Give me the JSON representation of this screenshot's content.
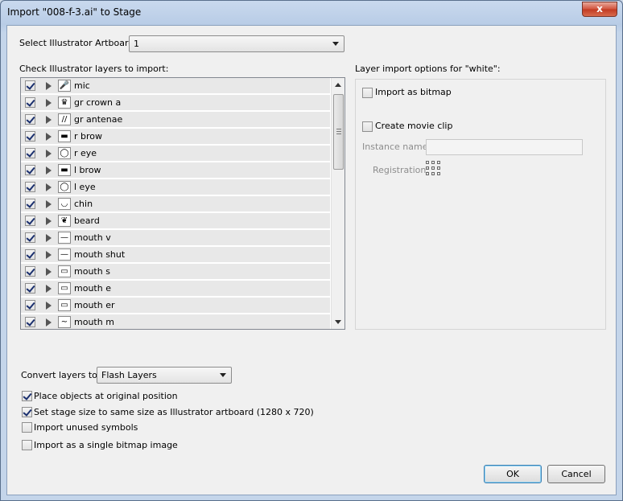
{
  "window": {
    "title": "Import \"008-f-3.ai\" to Stage",
    "close_glyph": "x"
  },
  "artboard": {
    "label": "Select Illustrator Artboard:",
    "value": "1"
  },
  "layers": {
    "label": "Check Illustrator layers to import:",
    "items": [
      {
        "name": "mic",
        "checked": true,
        "icon": "mic-thumbnail",
        "glyph": "🎤"
      },
      {
        "name": "gr crown a",
        "checked": true,
        "icon": "crown-thumbnail",
        "glyph": "♛"
      },
      {
        "name": "gr antenae",
        "checked": true,
        "icon": "antenna-thumbnail",
        "glyph": "//"
      },
      {
        "name": "r brow",
        "checked": true,
        "icon": "brow-thumbnail",
        "glyph": "▬"
      },
      {
        "name": "r eye",
        "checked": true,
        "icon": "eye-thumbnail",
        "glyph": "◯"
      },
      {
        "name": "l brow",
        "checked": true,
        "icon": "brow-thumbnail",
        "glyph": "▬"
      },
      {
        "name": "l eye",
        "checked": true,
        "icon": "eye-thumbnail",
        "glyph": "◯"
      },
      {
        "name": "chin",
        "checked": true,
        "icon": "chin-thumbnail",
        "glyph": "◡"
      },
      {
        "name": "beard",
        "checked": true,
        "icon": "beard-thumbnail",
        "glyph": "❦"
      },
      {
        "name": "mouth v",
        "checked": true,
        "icon": "mouth-thumbnail",
        "glyph": "—"
      },
      {
        "name": "mouth shut",
        "checked": true,
        "icon": "mouth-thumbnail",
        "glyph": "—"
      },
      {
        "name": "mouth s",
        "checked": true,
        "icon": "mouth-thumbnail",
        "glyph": "▭"
      },
      {
        "name": "mouth e",
        "checked": true,
        "icon": "mouth-thumbnail",
        "glyph": "▭"
      },
      {
        "name": "mouth er",
        "checked": true,
        "icon": "mouth-thumbnail",
        "glyph": "▭"
      },
      {
        "name": "mouth m",
        "checked": true,
        "icon": "mouth-thumbnail",
        "glyph": "~"
      }
    ]
  },
  "options": {
    "label": "Layer import options for \"white\":",
    "import_as_bitmap": {
      "label": "Import as bitmap",
      "checked": false
    },
    "create_movie_clip": {
      "label": "Create movie clip",
      "checked": false
    },
    "instance_name": {
      "label": "Instance name:",
      "value": ""
    },
    "registration": {
      "label": "Registration:"
    }
  },
  "convert": {
    "label": "Convert layers to:",
    "value": "Flash Layers"
  },
  "checks": [
    {
      "label": "Place objects at original position",
      "checked": true
    },
    {
      "label": "Set stage size to same size as Illustrator artboard (1280 x 720)",
      "checked": true
    },
    {
      "label": "Import unused symbols",
      "checked": false
    },
    {
      "label": "Import as a single bitmap image",
      "checked": false
    }
  ],
  "buttons": {
    "ok": "OK",
    "cancel": "Cancel"
  }
}
